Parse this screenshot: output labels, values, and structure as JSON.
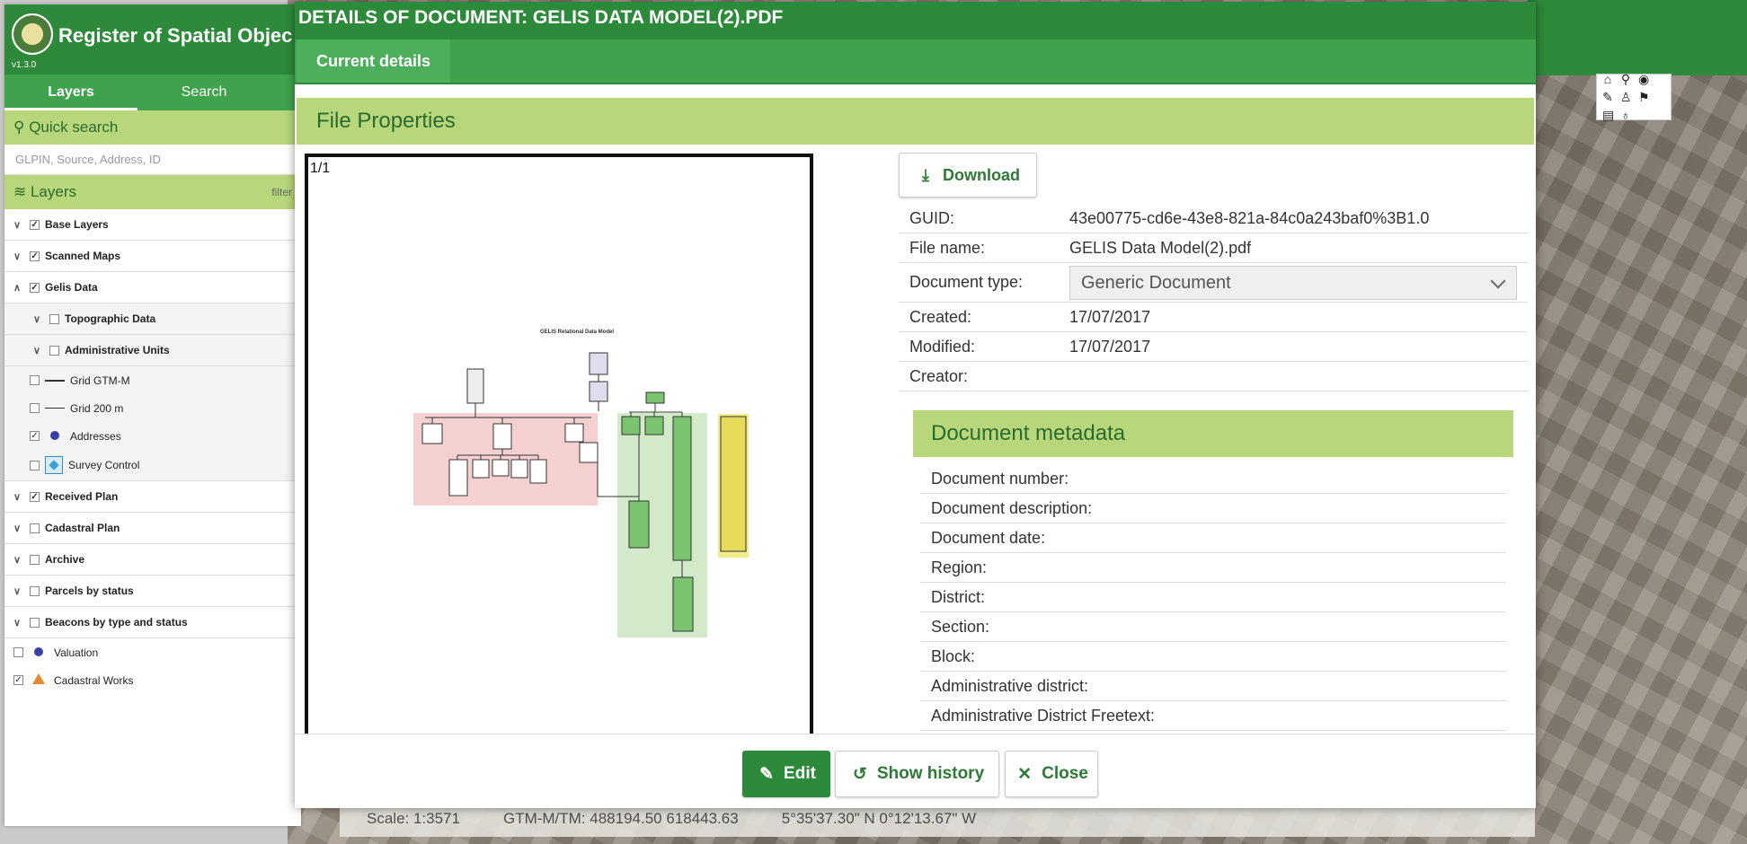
{
  "app": {
    "title": "Register of Spatial Objects",
    "title_visible": "Register of Spatial Objec",
    "version": "v1.3.0"
  },
  "sidebar": {
    "tabs": [
      {
        "label": "Layers"
      },
      {
        "label": "Search"
      }
    ],
    "quick_search": {
      "label": "Quick search",
      "placeholder": "GLPIN, Source, Address, ID"
    },
    "layers_header": {
      "label": "Layers",
      "filter": "filter"
    },
    "layers": [
      {
        "label": "Base Layers",
        "checked": true,
        "expanded": false
      },
      {
        "label": "Scanned Maps",
        "checked": true,
        "expanded": false
      },
      {
        "label": "Gelis Data",
        "checked": true,
        "expanded": true
      },
      {
        "label": "Topographic Data",
        "checked": false,
        "expanded": false
      },
      {
        "label": "Administrative Units",
        "checked": false,
        "expanded": false
      },
      {
        "label": "Grid GTM-M",
        "checked": false
      },
      {
        "label": "Grid 200 m",
        "checked": false
      },
      {
        "label": "Addresses",
        "checked": true
      },
      {
        "label": "Survey Control",
        "checked": false
      },
      {
        "label": "Received Plan",
        "checked": true,
        "expanded": false
      },
      {
        "label": "Cadastral Plan",
        "checked": false,
        "expanded": false
      },
      {
        "label": "Archive",
        "checked": false,
        "expanded": false
      },
      {
        "label": "Parcels by status",
        "checked": false,
        "expanded": false
      },
      {
        "label": "Beacons by type and status",
        "checked": false,
        "expanded": false
      },
      {
        "label": "Valuation",
        "checked": false
      },
      {
        "label": "Cadastral Works",
        "checked": true
      }
    ]
  },
  "map": {
    "status": {
      "scale": "Scale: 1:3571",
      "gtm": "GTM-M/TM: 488194.50 618443.63",
      "latlon": "5°35'37.30\" N 0°12'13.67\" W"
    },
    "toolbar_icons": [
      "home-icon",
      "pin-icon",
      "eye-icon",
      "pen-icon",
      "person-icon",
      "flag-icon",
      "print-icon",
      "clear-icon"
    ]
  },
  "modal": {
    "title": "DETAILS OF DOCUMENT: GELIS DATA MODEL(2).PDF",
    "tabs": [
      {
        "label": "Current details"
      }
    ],
    "section_title": "File Properties",
    "preview": {
      "page": "1/1",
      "doc_heading": "GELIS Relational Data Model"
    },
    "download_label": "Download",
    "properties": {
      "guid": {
        "label": "GUID:",
        "value": "43e00775-cd6e-43e8-821a-84c0a243baf0%3B1.0"
      },
      "file_name": {
        "label": "File name:",
        "value": "GELIS Data Model(2).pdf"
      },
      "document_type": {
        "label": "Document type:",
        "value": "Generic Document"
      },
      "created": {
        "label": "Created:",
        "value": "17/07/2017"
      },
      "modified": {
        "label": "Modified:",
        "value": "17/07/2017"
      },
      "creator": {
        "label": "Creator:",
        "value": ""
      }
    },
    "metadata_title": "Document metadata",
    "metadata": [
      {
        "label": "Document number:"
      },
      {
        "label": "Document description:"
      },
      {
        "label": "Document date:"
      },
      {
        "label": "Region:"
      },
      {
        "label": "District:"
      },
      {
        "label": "Section:"
      },
      {
        "label": "Block:"
      },
      {
        "label": "Administrative district:"
      },
      {
        "label": "Administrative District Freetext:"
      }
    ],
    "buttons": {
      "edit": "Edit",
      "history": "Show history",
      "close": "Close"
    }
  }
}
